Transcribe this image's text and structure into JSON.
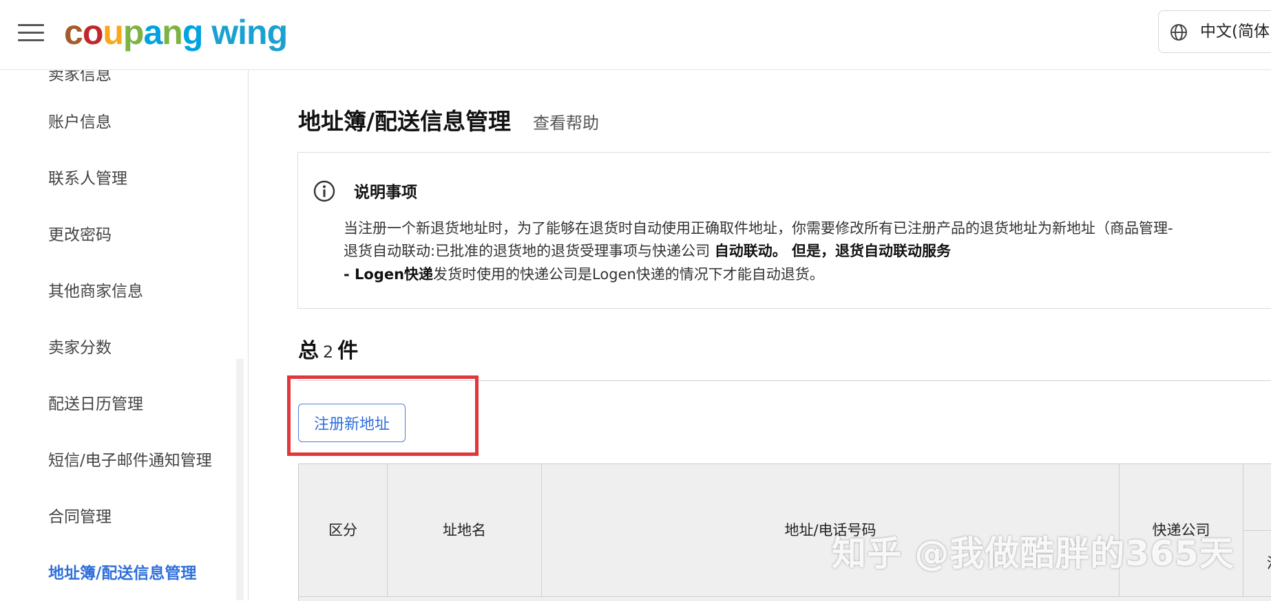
{
  "header": {
    "logo": {
      "coupang": [
        "c",
        "o",
        "u",
        "p",
        "a",
        "n",
        "g"
      ],
      "wing": "wing"
    },
    "colors": {
      "logo_letters": [
        "#a45b2c",
        "#c1272d",
        "#f7a81b",
        "#7cb342",
        "#00a3e0",
        "#7cb342",
        "#00a3e0"
      ],
      "wing": "#1ba1d1"
    },
    "language": "中文(简体",
    "menu_icon": "hamburger-icon",
    "language_icon": "globe-icon"
  },
  "sidebar": {
    "items": [
      {
        "label": "卖家信息"
      },
      {
        "label": "账户信息"
      },
      {
        "label": "联系人管理"
      },
      {
        "label": "更改密码"
      },
      {
        "label": "其他商家信息"
      },
      {
        "label": "卖家分数"
      },
      {
        "label": "配送日历管理"
      },
      {
        "label": "短信/电子邮件通知管理"
      },
      {
        "label": "合同管理"
      },
      {
        "label": "地址簿/配送信息管理",
        "active": true
      }
    ],
    "active_color": "#2f6fdb"
  },
  "main": {
    "title": "地址簿/配送信息管理",
    "help_link": "查看帮助",
    "notice": {
      "icon": "info-icon",
      "title": "说明事项",
      "line1": "当注册一个新退货地址时，为了能够在退货时自动使用正确取件地址，你需要修改所有已注册产品的退货地址为新地址（商品管理-",
      "line2a": "退货自动联动:已批准的退货地的退货受理事项与快递公司 ",
      "line2b": "自动联动。 但是，退货自动联动服务",
      "line3a": "- Logen快递",
      "line3b": "发货时使用的快递公司是Logen快递的情况下才能自动退货。"
    },
    "total": {
      "prefix": "总",
      "count": "2",
      "suffix": "件"
    },
    "register_button": "注册新地址",
    "highlight_color": "#e0373c",
    "table": {
      "columns": [
        "区分",
        "址地名",
        "地址/电话号码",
        "快递公司",
        "活"
      ]
    }
  },
  "watermark": "知乎 @我做酷胖的365天"
}
